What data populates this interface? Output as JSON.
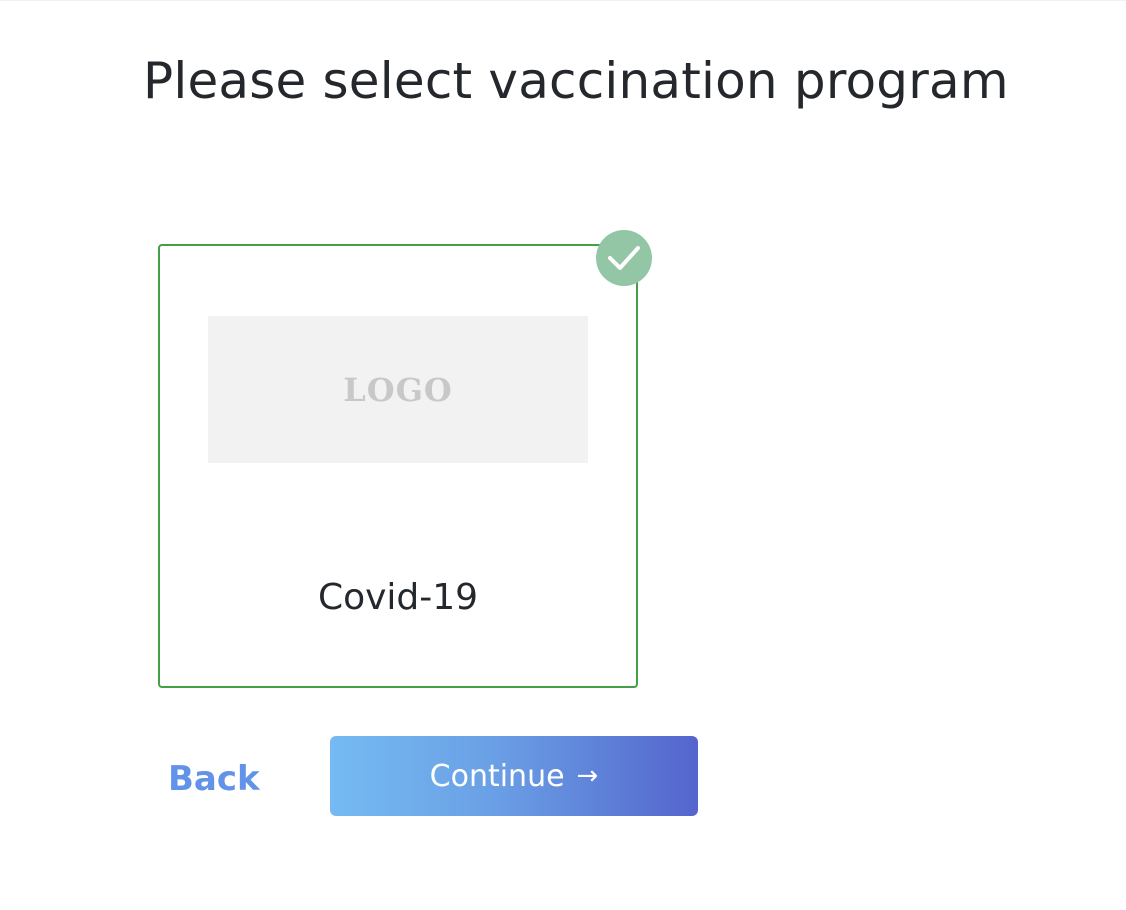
{
  "page": {
    "title": "Please select vaccination program"
  },
  "programs": [
    {
      "name": "Covid-19",
      "logo_placeholder": "LOGO",
      "selected": true
    }
  ],
  "actions": {
    "back_label": "Back",
    "continue_label": "Continue",
    "continue_icon": "arrow-right-icon"
  },
  "colors": {
    "selected_border": "#43a047",
    "check_badge": "#93c6a4",
    "link": "#6293e8",
    "button_gradient_start": "#75bbf2",
    "button_gradient_end": "#5465cd",
    "title_text": "#24272c"
  }
}
